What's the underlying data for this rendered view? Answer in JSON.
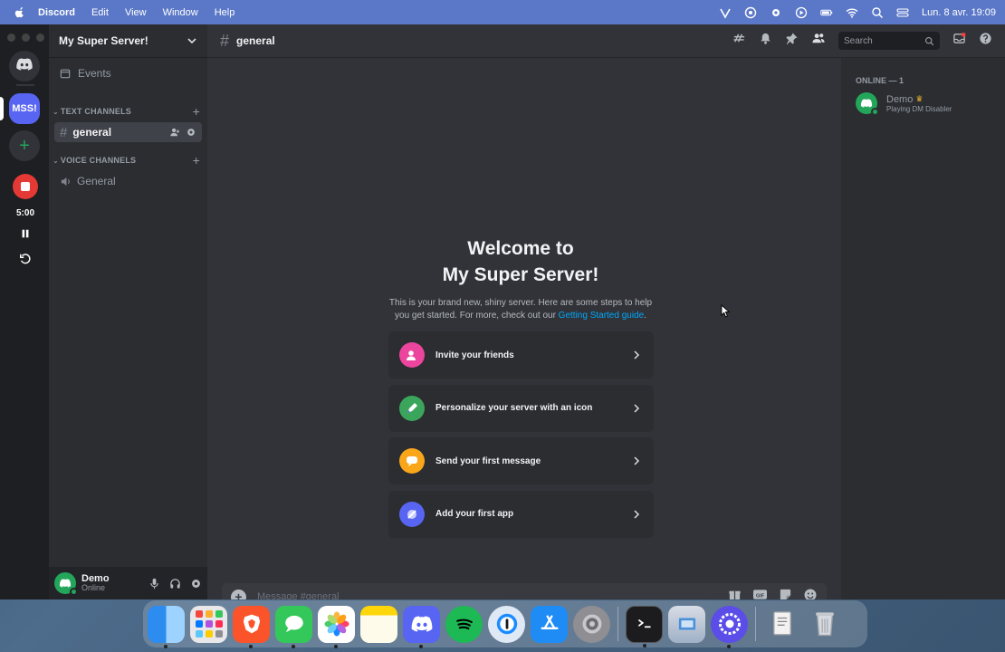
{
  "menubar": {
    "app_name": "Discord",
    "items": [
      "Edit",
      "View",
      "Window",
      "Help"
    ],
    "clock": "Lun. 8 avr.  19:09"
  },
  "server": {
    "name": "My Super Server!",
    "short": "MSS!"
  },
  "sidebar": {
    "events_label": "Events",
    "text_category": "TEXT CHANNELS",
    "voice_category": "VOICE CHANNELS",
    "text_channels": [
      "general"
    ],
    "voice_channels": [
      "General"
    ]
  },
  "recorder": {
    "time": "5:00"
  },
  "user": {
    "name": "Demo",
    "status": "Online"
  },
  "chat": {
    "channel": "general",
    "search_placeholder": "Search",
    "welcome_line1": "Welcome to",
    "welcome_line2": "My Super Server!",
    "intro_line1": "This is your brand new, shiny server. Here are some steps to help",
    "intro_line2": "you get started. For more, check out our ",
    "intro_link": "Getting Started guide",
    "intro_end": ".",
    "cards": [
      {
        "label": "Invite your friends",
        "icon": "invite-icon",
        "color": "#eb459e"
      },
      {
        "label": "Personalize your server with an icon",
        "icon": "personalize-icon",
        "color": "#3ba55c"
      },
      {
        "label": "Send your first message",
        "icon": "message-icon",
        "color": "#faa61a"
      },
      {
        "label": "Add your first app",
        "icon": "app-icon",
        "color": "#5865f2"
      }
    ],
    "composer_placeholder": "Message #general"
  },
  "members": {
    "header": "ONLINE — 1",
    "list": [
      {
        "name": "Demo",
        "activity": "Playing DM Disabler"
      }
    ]
  },
  "colors": {
    "accent": "#5865f2",
    "online": "#23a55a",
    "link": "#00a8fc",
    "record": "#e53935"
  },
  "dock": {
    "apps": [
      "finder-icon",
      "launchpad-icon",
      "brave-icon",
      "messages-icon",
      "photos-icon",
      "notes-icon",
      "discord-icon",
      "spotify-icon",
      "onepassword-icon",
      "appstore-icon",
      "settings-icon",
      "terminal-icon",
      "preview-icon",
      "apps-icon",
      "documents-icon",
      "trash-icon"
    ]
  }
}
